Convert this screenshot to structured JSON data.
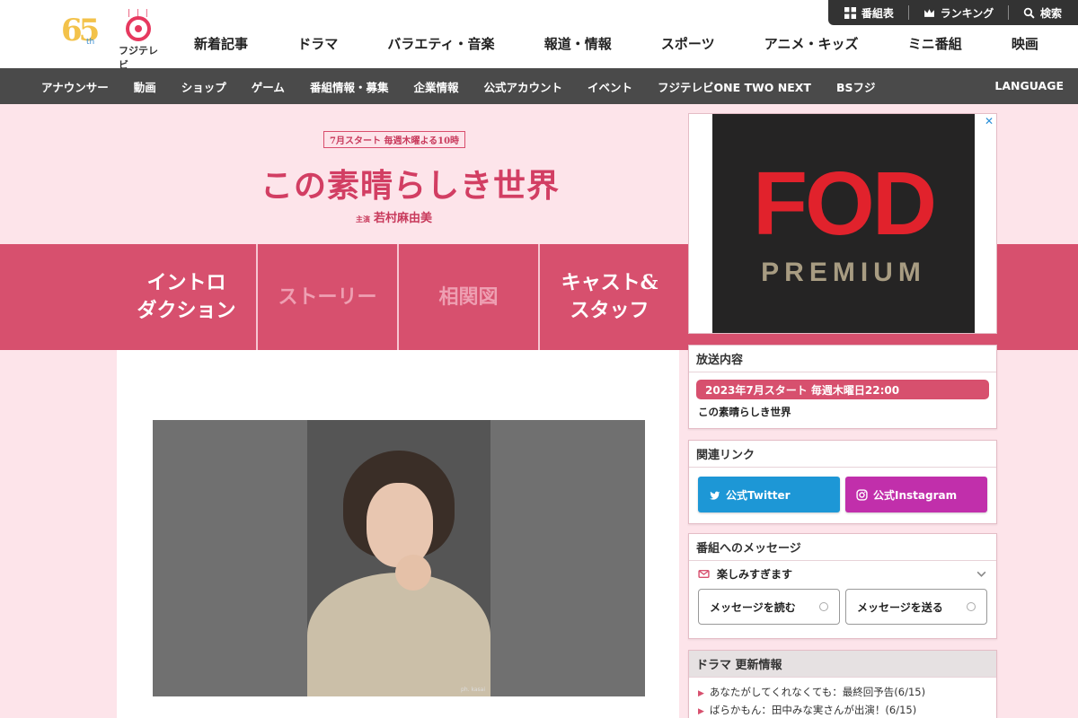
{
  "header": {
    "logo_65": "65",
    "logo_th": "th",
    "logo_fuji": "フジテレビ",
    "topbar": {
      "schedule": "番組表",
      "ranking": "ランキング",
      "search": "検索"
    },
    "nav": [
      "新着記事",
      "ドラマ",
      "バラエティ・音楽",
      "報道・情報",
      "スポーツ",
      "アニメ・キッズ",
      "ミニ番組",
      "映画"
    ]
  },
  "subnav": {
    "items": [
      "アナウンサー",
      "動画",
      "ショップ",
      "ゲーム",
      "番組情報・募集",
      "企業情報",
      "公式アカウント",
      "イベント",
      "フジテレビONE TWO NEXT",
      "BSフジ"
    ],
    "language": "LANGUAGE"
  },
  "hero": {
    "schedule": "7月スタート 毎週木曜よる10時",
    "title": "この素晴らしき世界",
    "star_prefix": "主演",
    "star": "若村麻由美"
  },
  "tabs": [
    {
      "line1": "イントロ",
      "line2": "ダクション"
    },
    {
      "line1": "ストーリー",
      "line2": ""
    },
    {
      "line1": "相関図",
      "line2": ""
    },
    {
      "line1": "キャスト&",
      "line2": "スタッフ"
    }
  ],
  "photo": {
    "credit": "ph. kasai"
  },
  "ad": {
    "brand": "FOD",
    "tier": "PREMIUM",
    "close": "✕"
  },
  "broadcast": {
    "heading": "放送内容",
    "date": "2023年7月スタート 毎週木曜日22:00",
    "program": "この素晴らしき世界"
  },
  "links": {
    "heading": "関連リンク",
    "twitter": "公式Twitter",
    "instagram": "公式Instagram"
  },
  "message": {
    "heading": "番組へのメッセージ",
    "selected": "楽しみすぎます",
    "read": "メッセージを読む",
    "send": "メッセージを送る"
  },
  "drama_news": {
    "heading": "ドラマ 更新情報",
    "items": [
      "あなたがしてくれなくても：最終回予告(6/15)",
      "ばらかもん：田中みな実さんが出演！(6/15)"
    ]
  },
  "colors": {
    "accent": "#d7506e",
    "pink_bg": "#fde4ea",
    "twitter": "#1d97d6",
    "instagram": "#c12fab",
    "fod_red": "#e1222c"
  }
}
